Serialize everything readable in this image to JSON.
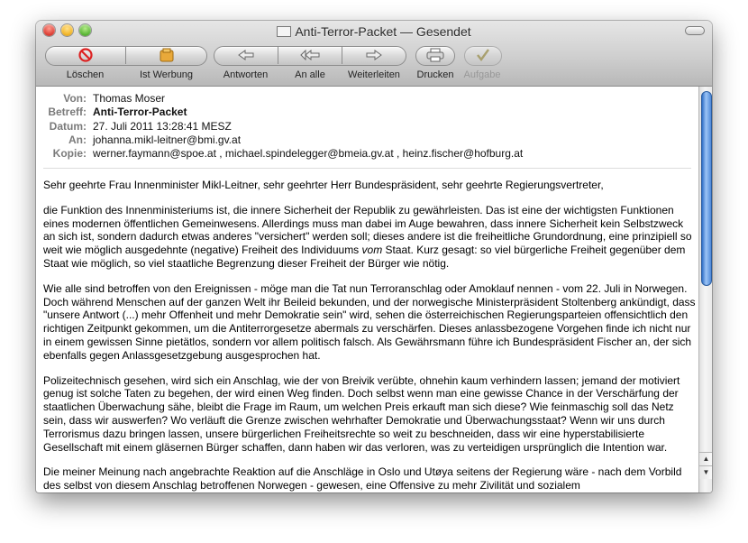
{
  "window": {
    "title": "Anti-Terror-Packet — Gesendet"
  },
  "toolbar": {
    "delete": "Löschen",
    "junk": "Ist Werbung",
    "reply": "Antworten",
    "reply_all": "An alle",
    "forward": "Weiterleiten",
    "print": "Drucken",
    "todo": "Aufgabe"
  },
  "header": {
    "from_label": "Von:",
    "from": "Thomas Moser",
    "subject_label": "Betreff:",
    "subject": "Anti-Terror-Packet",
    "date_label": "Datum:",
    "date": "27. Juli 2011 13:28:41 MESZ",
    "to_label": "An:",
    "to": "johanna.mikl-leitner@bmi.gv.at",
    "cc_label": "Kopie:",
    "cc": "werner.faymann@spoe.at ,   michael.spindelegger@bmeia.gv.at ,   heinz.fischer@hofburg.at"
  },
  "body": {
    "greeting": "Sehr geehrte Frau Innenminister Mikl-Leitner, sehr geehrter Herr Bundespräsident, sehr geehrte Regierungsvertreter,",
    "p1a": "die Funktion des Innenministeriums ist, die innere Sicherheit der Republik zu gewährleisten. Das ist eine der wichtigsten Funktionen eines modernen öffentlichen Gemeinwesens. Allerdings muss man dabei im Auge bewahren, dass innere Sicherheit kein Selbstzweck an sich ist, sondern dadurch etwas anderes \"versichert\" werden soll; dieses andere ist die freiheitliche Grundordnung, eine prinzipiell so weit wie möglich ausgedehnte (negative) Freiheit des Individuums ",
    "p1_em": "vom",
    "p1b": " Staat. Kurz gesagt: so viel bürgerliche Freiheit gegenüber dem Staat wie möglich, so viel staatliche Begrenzung dieser Freiheit der Bürger wie nötig.",
    "p2": "Wie alle sind betroffen von den Ereignissen - möge man die Tat nun Terroranschlag oder Amoklauf nennen - vom 22. Juli in Norwegen. Doch während Menschen auf der ganzen Welt ihr Beileid bekunden, und der norwegische Ministerpräsident Stoltenberg ankündigt, dass \"unsere Antwort (...) mehr Offenheit und mehr Demokratie sein\" wird, sehen die österreichischen Regierungsparteien offensichtlich den richtigen Zeitpunkt gekommen, um die Antiterrorgesetze abermals zu verschärfen. Dieses anlassbezogene Vorgehen finde ich nicht nur in einem gewissen Sinne pietätlos, sondern vor allem politisch falsch. Als Gewährsmann führe ich Bundespräsident Fischer an, der sich ebenfalls gegen Anlassgesetzgebung ausgesprochen hat.",
    "p3": "Polizeitechnisch gesehen, wird sich ein Anschlag, wie der von Breivik verübte, ohnehin kaum verhindern lassen; jemand der motiviert genug ist solche Taten zu begehen, der wird einen Weg finden. Doch selbst wenn man eine gewisse Chance in der Verschärfung der staatlichen Überwachung sähe, bleibt die Frage im Raum, um welchen Preis erkauft man sich diese? Wie feinmaschig soll das Netz sein, dass wir auswerfen? Wo verläuft die Grenze zwischen wehrhafter Demokratie und Überwachungsstaat? Wenn wir uns durch Terrorismus dazu bringen lassen, unsere bürgerlichen Freiheitsrechte so weit zu beschneiden, dass wir eine hyperstabilisierte Gesellschaft mit einem gläsernen Bürger schaffen, dann haben wir das verloren, was zu verteidigen ursprünglich die Intention war.",
    "p4": "Die meiner Meinung nach angebrachte Reaktion auf die Anschläge in Oslo und Utøya seitens der Regierung wäre - nach dem Vorbild des selbst von diesem Anschlag betroffenen Norwegen - gewesen, eine Offensive zu mehr Zivilität und sozialem"
  },
  "icons": {
    "delete": "no-entry-icon",
    "junk": "junk-bag-icon",
    "reply": "reply-arrow-icon",
    "reply_all": "reply-all-arrow-icon",
    "forward": "forward-arrow-icon",
    "print": "printer-icon",
    "todo": "checkmark-icon"
  }
}
